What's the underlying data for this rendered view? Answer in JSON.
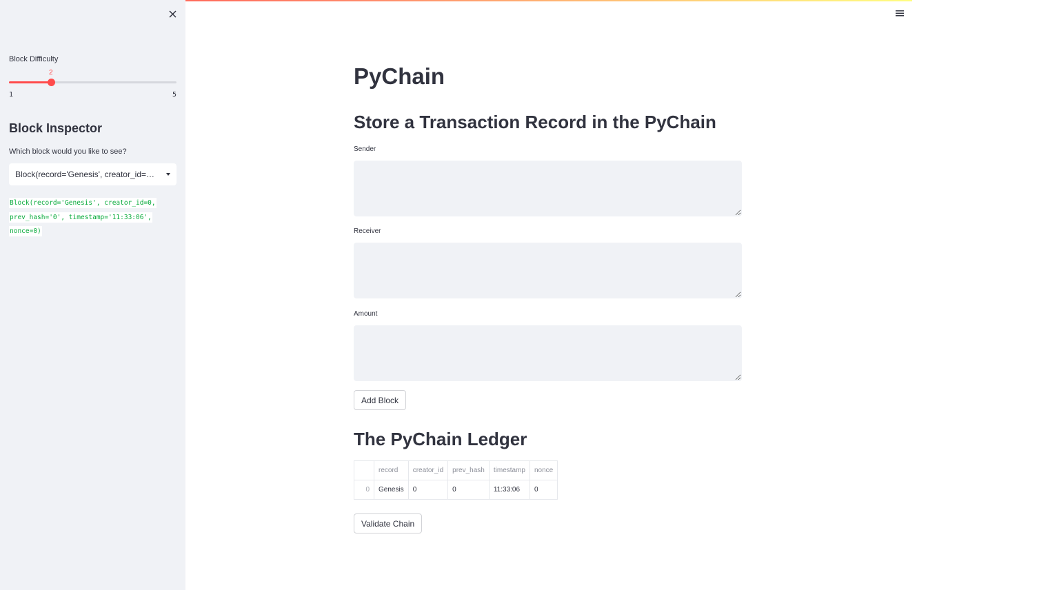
{
  "sidebar": {
    "difficulty_label": "Block Difficulty",
    "slider": {
      "value": 2,
      "min": 1,
      "max": 5
    },
    "inspector_title": "Block Inspector",
    "select_prompt": "Which block would you like to see?",
    "select_value": "Block(record='Genesis', creator_id=0, prev_hash='0', timestamp='11:33:06', nonce=0)",
    "code_output": "Block(record='Genesis', creator_id=0, prev_hash='0', timestamp='11:33:06', nonce=0)"
  },
  "main": {
    "title": "PyChain",
    "section_title": "Store a Transaction Record in the PyChain",
    "sender_label": "Sender",
    "receiver_label": "Receiver",
    "amount_label": "Amount",
    "sender_value": "",
    "receiver_value": "",
    "amount_value": "",
    "add_block_label": "Add Block",
    "ledger_title": "The PyChain Ledger",
    "ledger": {
      "columns": [
        "",
        "record",
        "creator_id",
        "prev_hash",
        "timestamp",
        "nonce"
      ],
      "rows": [
        [
          "0",
          "Genesis",
          "0",
          "0",
          "11:33:06",
          "0"
        ]
      ]
    },
    "validate_label": "Validate Chain"
  },
  "colors": {
    "accent": "#ff4b4b",
    "code_green": "#09ab3b",
    "sidebar_bg": "#f0f2f6",
    "text": "#31333f"
  },
  "icons": {
    "close": "close-icon",
    "menu": "hamburger-menu-icon",
    "dropdown": "chevron-down-icon"
  }
}
